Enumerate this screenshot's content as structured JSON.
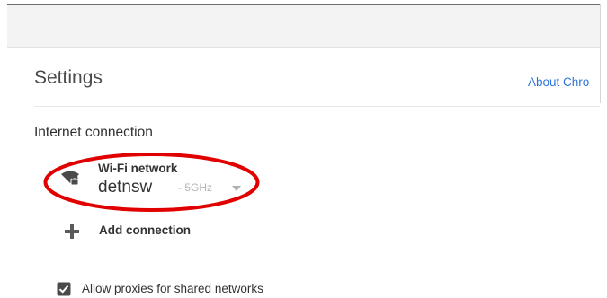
{
  "header": {
    "title": "Settings",
    "about_link": "About Chro"
  },
  "internet": {
    "section_title": "Internet connection",
    "network": {
      "type": "Wi-Fi network",
      "name": "detnsw",
      "band": "- 5GHz",
      "icon": "wifi-locked-icon",
      "dropdown_icon": "chevron-down-icon"
    },
    "add_connection": {
      "label": "Add connection",
      "icon": "plus-icon"
    },
    "proxy_option": {
      "label": "Allow proxies for shared networks",
      "checked": true
    }
  },
  "annotation": {
    "shape": "ellipse",
    "color": "#e00000"
  },
  "colors": {
    "link": "#2f73d9",
    "checkbox": "#4a4a4a",
    "muted_text": "#b4b4b4"
  }
}
